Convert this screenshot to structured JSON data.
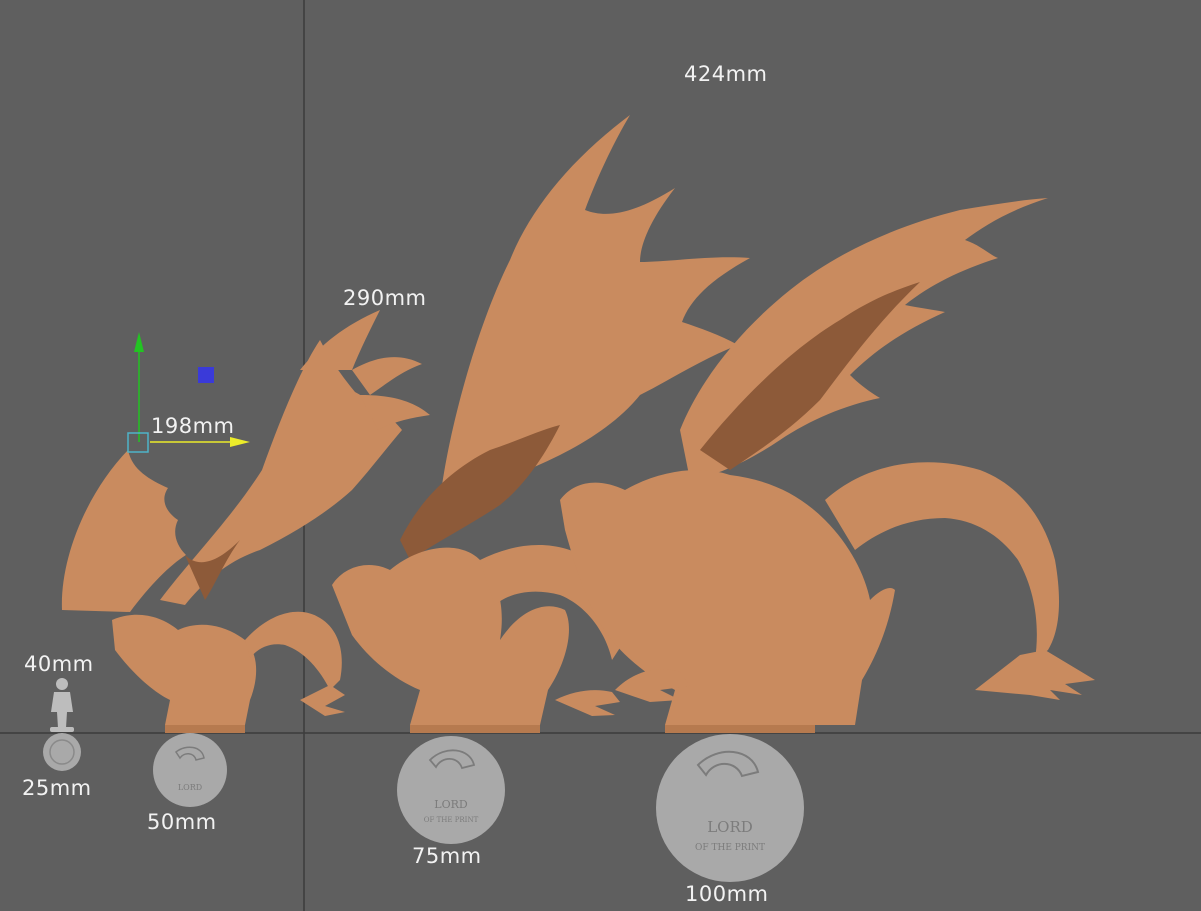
{
  "viewport": {
    "background_color": "#5f5f5f",
    "grid_line_color": "#3c3c3c",
    "model_color": "#c98b5f",
    "model_shadow_color": "#8d5a39",
    "base_color": "#a9a9a9",
    "gizmo": {
      "y_axis_color": "#22c422",
      "x_axis_color": "#ecec2a",
      "plane_handle_color": "#3a3ad9",
      "pivot_color": "#4fb4c8"
    }
  },
  "height_labels": {
    "mini": "40mm",
    "small": "198mm",
    "medium": "290mm",
    "large": "424mm"
  },
  "base_labels": {
    "mini": "25mm",
    "small": "50mm",
    "medium": "75mm",
    "large": "100mm"
  },
  "models": [
    {
      "name": "reference miniature",
      "scale": "40mm"
    },
    {
      "name": "dragon small",
      "scale": "198mm"
    },
    {
      "name": "dragon medium",
      "scale": "290mm"
    },
    {
      "name": "dragon large",
      "scale": "424mm"
    }
  ],
  "base_logo_text": [
    "LORD",
    "OF THE PRINT"
  ]
}
